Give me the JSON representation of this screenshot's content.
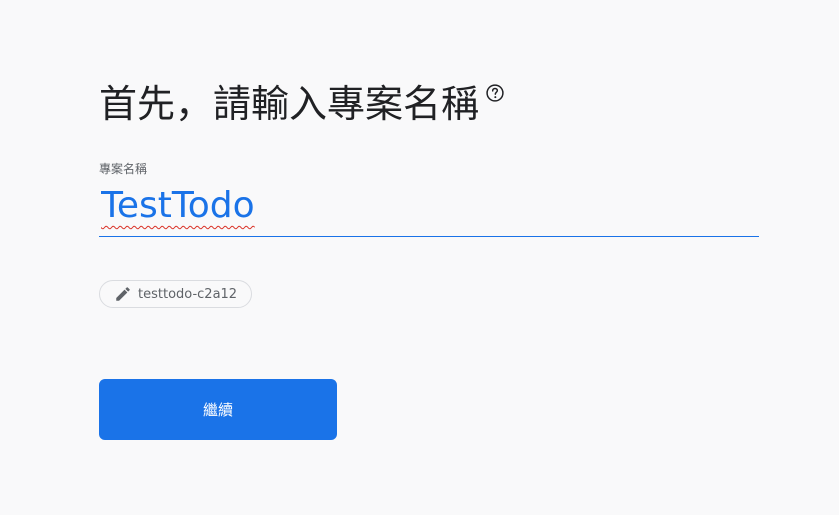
{
  "heading": {
    "title": "首先，請輸入專案名稱",
    "help_icon": "help-circle-icon"
  },
  "project_name_field": {
    "label": "專案名稱",
    "value": "TestTodo"
  },
  "project_id_chip": {
    "icon": "pencil-icon",
    "text": "testtodo-c2a12"
  },
  "continue_button": {
    "label": "繼續"
  },
  "colors": {
    "accent": "#1a73e8",
    "background": "#f9f9fa",
    "title_text": "#202124",
    "muted_text": "#5f6368",
    "spellcheck": "#d93025"
  }
}
